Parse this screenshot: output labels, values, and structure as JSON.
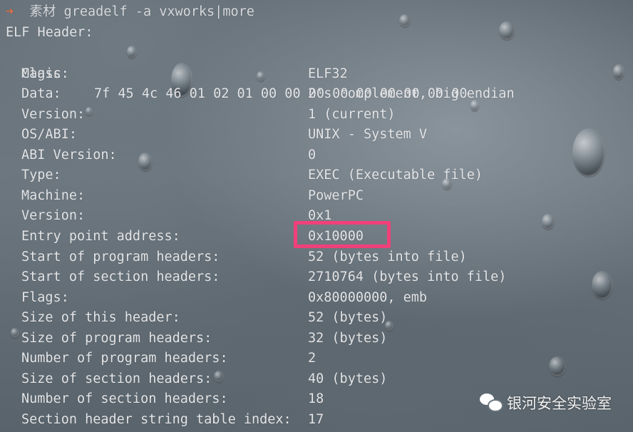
{
  "prompt": {
    "arrow": "➜",
    "command": "素材 greadelf -a vxworks|more"
  },
  "elf_header": {
    "title": "ELF Header:",
    "magic_label": "Magic:",
    "magic_value": "7f 45 4c 46 01 02 01 00 00 00 00 00 00 00 00 00",
    "fields": [
      {
        "key": "Class:",
        "value": "ELF32"
      },
      {
        "key": "Data:",
        "value": "2's complement, big endian"
      },
      {
        "key": "Version:",
        "value": "1 (current)"
      },
      {
        "key": "OS/ABI:",
        "value": "UNIX - System V"
      },
      {
        "key": "ABI Version:",
        "value": "0"
      },
      {
        "key": "Type:",
        "value": "EXEC (Executable file)"
      },
      {
        "key": "Machine:",
        "value": "PowerPC"
      },
      {
        "key": "Version:",
        "value": "0x1"
      },
      {
        "key": "Entry point address:",
        "value": "0x10000"
      },
      {
        "key": "Start of program headers:",
        "value": "52 (bytes into file)"
      },
      {
        "key": "Start of section headers:",
        "value": "2710764 (bytes into file)"
      },
      {
        "key": "Flags:",
        "value": "0x80000000, emb"
      },
      {
        "key": "Size of this header:",
        "value": "52 (bytes)"
      },
      {
        "key": "Size of program headers:",
        "value": "32 (bytes)"
      },
      {
        "key": "Number of program headers:",
        "value": "2"
      },
      {
        "key": "Size of section headers:",
        "value": "40 (bytes)"
      },
      {
        "key": "Number of section headers:",
        "value": "18"
      },
      {
        "key": "Section header string table index:",
        "value": "17"
      }
    ]
  },
  "highlight": {
    "target": "Entry point address",
    "color": "#f0407a"
  },
  "watermark": {
    "icon": "wechat-icon",
    "text": "银河安全实验室"
  }
}
